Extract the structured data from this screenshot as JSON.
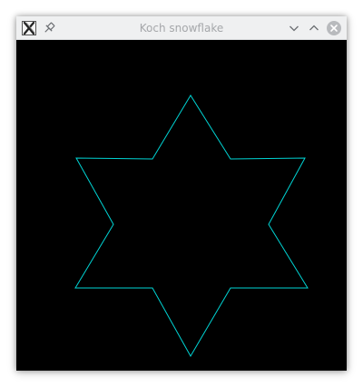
{
  "window": {
    "title": "Koch snowflake",
    "icons": {
      "app": "x11-app-icon",
      "pin": "pin-icon",
      "minimize": "chevron-down-icon",
      "maximize": "chevron-up-icon",
      "close": "close-icon"
    }
  },
  "canvas": {
    "background": "#000000",
    "stroke_color": "#00d4d4",
    "shape": "koch-snowflake-iteration-1"
  }
}
